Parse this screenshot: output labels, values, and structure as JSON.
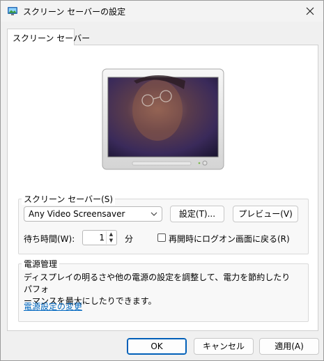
{
  "window": {
    "title": "スクリーン セーバーの設定",
    "close_icon": "close-icon"
  },
  "tab": {
    "label": "スクリーン セーバー"
  },
  "screensaver": {
    "group_label": "スクリーン セーバー(S)",
    "selected": "Any Video Screensaver",
    "settings_button": "設定(T)...",
    "preview_button": "プレビュー(V)",
    "wait_label": "待ち時間(W):",
    "wait_value": "1",
    "wait_unit": "分",
    "resume_checkbox_label": "再開時にログオン画面に戻る(R)",
    "resume_checked": false
  },
  "power": {
    "group_label": "電源管理",
    "description_line1": "ディスプレイの明るさや他の電源の設定を調整して、電力を節約したりパフォ",
    "description_line2": "ーマンスを最大にしたりできます。",
    "link": "電源設定の変更"
  },
  "footer": {
    "ok": "OK",
    "cancel": "キャンセル",
    "apply": "適用(A)"
  },
  "colors": {
    "accent": "#005fb8",
    "link": "#0067c0",
    "window_bg": "#f0f0f0"
  }
}
